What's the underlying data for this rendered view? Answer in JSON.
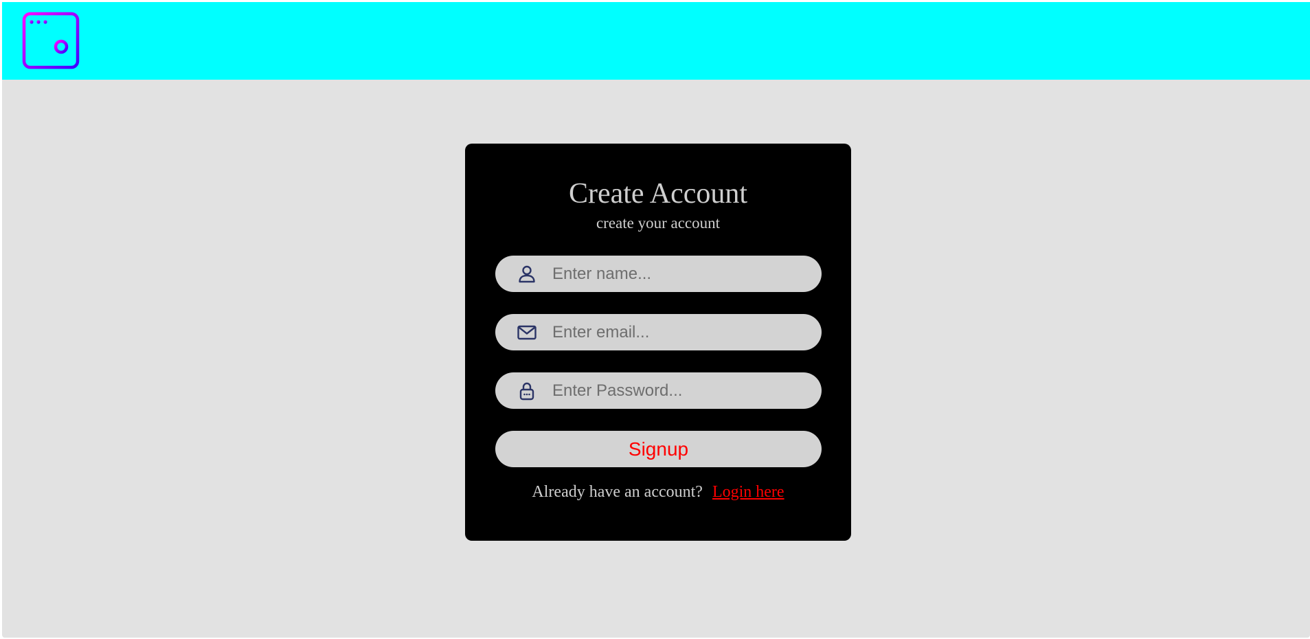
{
  "header": {
    "logo_icon": "browser-key-icon",
    "background": "#00ffff",
    "logo_gradient": [
      "#ff00ff",
      "#3a00ff"
    ]
  },
  "form": {
    "title": "Create Account",
    "subtitle": "create your account",
    "fields": [
      {
        "name": "name",
        "icon": "user-icon",
        "placeholder": "Enter name...",
        "value": ""
      },
      {
        "name": "email",
        "icon": "mail-icon",
        "placeholder": "Enter email...",
        "value": ""
      },
      {
        "name": "password",
        "icon": "lock-icon",
        "placeholder": "Enter Password...",
        "value": ""
      }
    ],
    "submit_label": "Signup",
    "login_prompt": "Already have an account?",
    "login_link": "Login here"
  },
  "colors": {
    "page_background": "#e2e2e2",
    "card_background": "#000000",
    "field_background": "#d3d3d3",
    "accent": "#ff0000",
    "text": "#cfcfcf",
    "icon": "#2b3466"
  }
}
